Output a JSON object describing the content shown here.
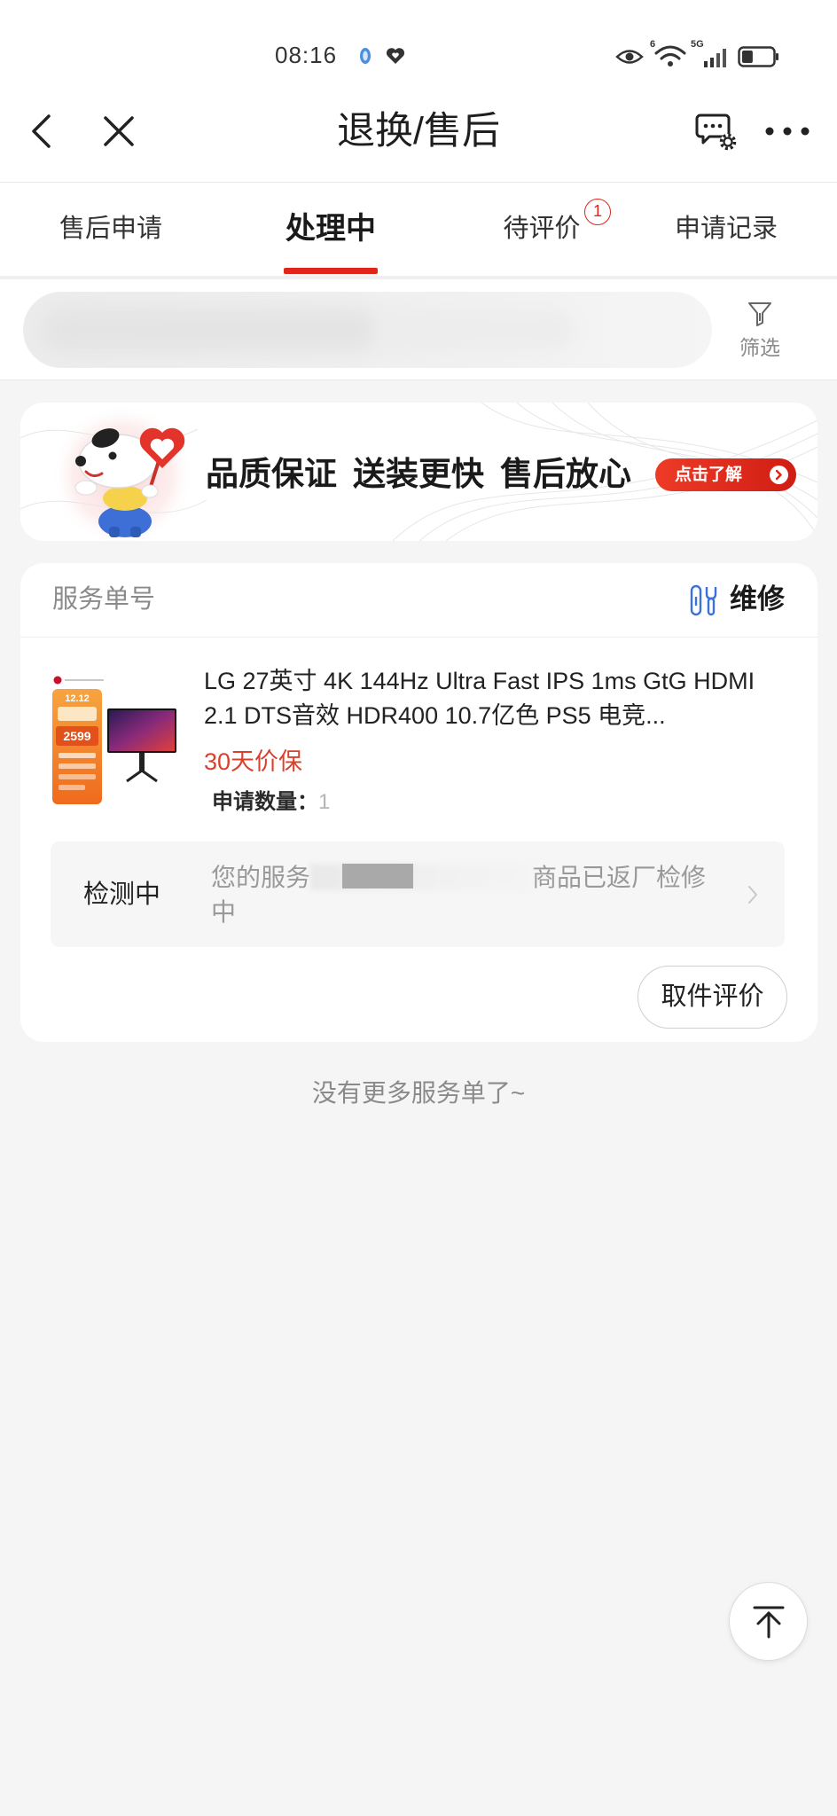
{
  "status_bar": {
    "time": "08:16",
    "wifi_badge": "6",
    "network": "5G",
    "battery_level": 35,
    "icons": [
      "app-notification-icon",
      "heart-icon",
      "eye-icon",
      "wifi-icon",
      "signal-icon",
      "battery-icon"
    ]
  },
  "header": {
    "title": "退换/售后",
    "icons": {
      "back": "chevron-left-icon",
      "close": "close-icon",
      "service": "chat-settings-icon",
      "more": "more-dots-icon"
    }
  },
  "tabs": [
    {
      "label": "售后申请",
      "active": false
    },
    {
      "label": "处理中",
      "active": true
    },
    {
      "label": "待评价",
      "active": false,
      "badge": "1"
    },
    {
      "label": "申请记录",
      "active": false
    }
  ],
  "search": {
    "filter_label": "筛选",
    "filter_icon": "funnel-icon"
  },
  "banner": {
    "slogan": [
      "品质保证",
      "送装更快",
      "售后放心"
    ],
    "button_label": "点击了解"
  },
  "service_order": {
    "number_label": "服务单号",
    "type_label": "维修",
    "type_icon": "repair-tools-icon",
    "product": {
      "title": "LG 27英寸 4K 144Hz Ultra Fast IPS 1ms GtG HDMI 2.1 DTS音效 HDR400 10.7亿色 PS5 电竞...",
      "price_protection": "30天价保",
      "quantity_label": "申请数量：",
      "quantity": "1",
      "image_text": {
        "promo_date": "12.12",
        "price": "2599"
      }
    },
    "status": {
      "label": "检测中",
      "message_prefix": "您的服务",
      "message_suffix": "商品已返厂检修中"
    },
    "action_label": "取件评价"
  },
  "footer": {
    "no_more": "没有更多服务单了~"
  },
  "colors": {
    "accent": "#e1251b",
    "page_background": "#f5f5f5",
    "card_background": "#ffffff",
    "text_primary": "#222222",
    "text_secondary": "#999999",
    "repair_icon": "#3a72d8",
    "price_red": "#d9412c"
  }
}
